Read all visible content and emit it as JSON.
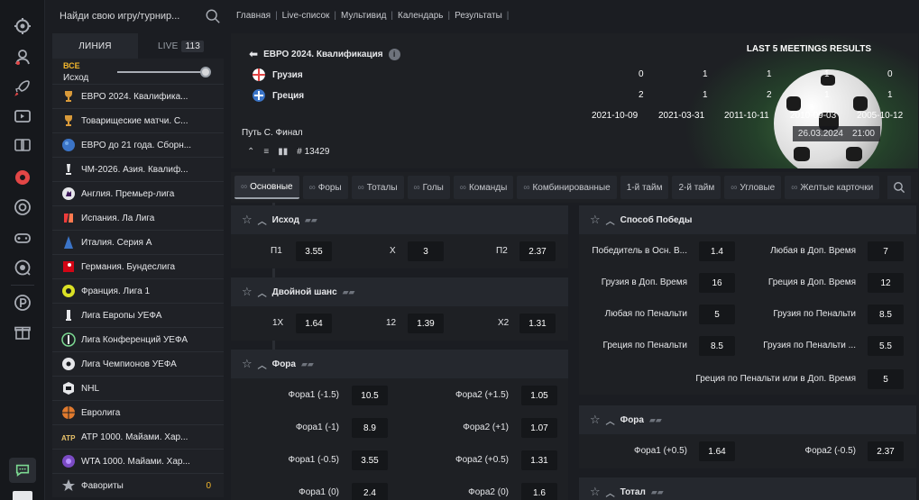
{
  "search": {
    "placeholder": "Найди свою игру/турнир..."
  },
  "tabs": {
    "line": "ЛИНИЯ",
    "live": "LIVE",
    "live_count": "113"
  },
  "filter": {
    "all": "ВСЕ",
    "label": "Исход"
  },
  "leagues": [
    {
      "name": "ЕВРО 2024. Квалифика...",
      "icon": "trophy-icon"
    },
    {
      "name": "Товарищеские матчи. С...",
      "icon": "trophy-icon"
    },
    {
      "name": "ЕВРО до 21 года. Сборн...",
      "icon": "globe-icon"
    },
    {
      "name": "ЧМ-2026. Азия. Квалиф...",
      "icon": "cup-icon"
    },
    {
      "name": "Англия. Премьер-лига",
      "icon": "lion-icon"
    },
    {
      "name": "Испания. Ла Лига",
      "icon": "laliga-icon"
    },
    {
      "name": "Италия. Серия А",
      "icon": "seriea-icon"
    },
    {
      "name": "Германия. Бундеслига",
      "icon": "bundesliga-icon"
    },
    {
      "name": "Франция. Лига 1",
      "icon": "ligue1-icon"
    },
    {
      "name": "Лига Европы УЕФА",
      "icon": "europa-icon"
    },
    {
      "name": "Лига Конференций УЕФА",
      "icon": "conference-icon"
    },
    {
      "name": "Лига Чемпионов УЕФА",
      "icon": "ucl-icon"
    },
    {
      "name": "NHL",
      "icon": "nhl-icon"
    },
    {
      "name": "Евролига",
      "icon": "basketball-icon"
    },
    {
      "name": "ATP 1000. Майами. Хар...",
      "icon": "atp-icon"
    },
    {
      "name": "WTA 1000. Майами. Хар...",
      "icon": "wta-icon"
    },
    {
      "name": "Фавориты",
      "icon": "star-icon",
      "count": "0"
    }
  ],
  "topnav": [
    "Главная",
    "Live-список",
    "Мультивид",
    "Календарь",
    "Результаты"
  ],
  "match": {
    "competition": "ЕВРО 2024. Квалификация",
    "last5_title": "LAST 5 MEETINGS RESULTS",
    "team1": "Грузия",
    "team2": "Греция",
    "scores1": [
      "0",
      "1",
      "1",
      "1",
      "0"
    ],
    "scores2": [
      "2",
      "1",
      "2",
      "1",
      "1"
    ],
    "dates": [
      "2021-10-09",
      "2021-03-31",
      "2011-10-11",
      "2010-09-03",
      "2005-10-12"
    ],
    "path": "Путь С. Финал",
    "id": "# 13429",
    "date": "26.03.2024",
    "time": "21:00"
  },
  "market_tabs": [
    "Основные",
    "Форы",
    "Тоталы",
    "Голы",
    "Команды",
    "Комбинированные",
    "1-й тайм",
    "2-й тайм",
    "Угловые",
    "Желтые карточки"
  ],
  "markets": {
    "outcome": {
      "title": "Исход",
      "p1": "П1",
      "p1_odd": "3.55",
      "x": "X",
      "x_odd": "3",
      "p2": "П2",
      "p2_odd": "2.37"
    },
    "double": {
      "title": "Двойной шанс",
      "a": "1X",
      "a_odd": "1.64",
      "b": "12",
      "b_odd": "1.39",
      "c": "X2",
      "c_odd": "1.31"
    },
    "handicap": {
      "title": "Фора",
      "rows": [
        {
          "l": "Фора1 (-1.5)",
          "lo": "10.5",
          "r": "Фора2 (+1.5)",
          "ro": "1.05"
        },
        {
          "l": "Фора1 (-1)",
          "lo": "8.9",
          "r": "Фора2 (+1)",
          "ro": "1.07"
        },
        {
          "l": "Фора1 (-0.5)",
          "lo": "3.55",
          "r": "Фора2 (+0.5)",
          "ro": "1.31"
        },
        {
          "l": "Фора1 (0)",
          "lo": "2.4",
          "r": "Фора2 (0)",
          "ro": "1.6"
        }
      ]
    },
    "method": {
      "title": "Способ Победы",
      "rows": [
        {
          "l": "Победитель в Осн. В...",
          "lo": "1.4",
          "r": "Любая в Доп. Время",
          "ro": "7"
        },
        {
          "l": "Грузия в Доп. Время",
          "lo": "16",
          "r": "Греция в Доп. Время",
          "ro": "12"
        },
        {
          "l": "Любая по Пенальти",
          "lo": "5",
          "r": "Грузия по Пенальти",
          "ro": "8.5"
        },
        {
          "l": "Греция по Пенальти",
          "lo": "8.5",
          "r": "Грузия по Пенальти ...",
          "ro": "5.5"
        }
      ],
      "last": {
        "l": "Греция по Пенальти или в Доп. Время",
        "o": "5"
      }
    },
    "handicap2": {
      "title": "Фора",
      "l": "Фора1 (+0.5)",
      "lo": "1.64",
      "r": "Фора2 (-0.5)",
      "ro": "2.37"
    },
    "total": {
      "title": "Тотал"
    }
  }
}
